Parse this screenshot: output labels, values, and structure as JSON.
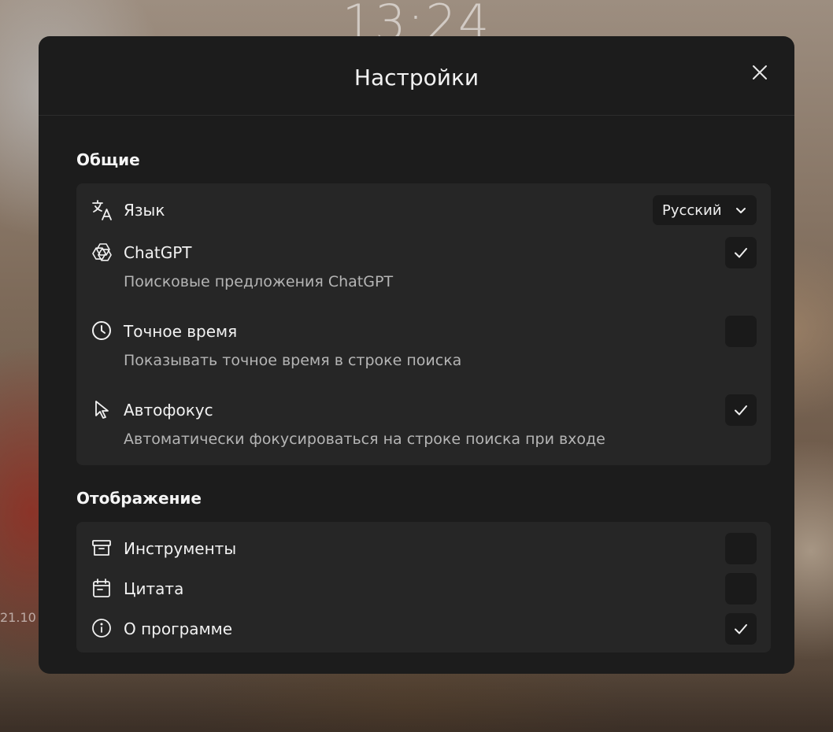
{
  "background": {
    "clock": "13:24",
    "side_label": "21.10"
  },
  "modal": {
    "title": "Настройки",
    "close_icon": "close-icon"
  },
  "sections": {
    "general": {
      "title": "Общие",
      "language": {
        "label": "Язык",
        "icon": "translate-icon",
        "selected": "Русский"
      },
      "chatgpt": {
        "label": "ChatGPT",
        "icon": "openai-icon",
        "description": "Поисковые предложения ChatGPT",
        "checked": true
      },
      "exact_time": {
        "label": "Точное время",
        "icon": "clock-icon",
        "description": "Показывать точное время в строке поиска",
        "checked": false
      },
      "autofocus": {
        "label": "Автофокус",
        "icon": "cursor-icon",
        "description": "Автоматически фокусироваться на строке поиска при входе",
        "checked": true
      }
    },
    "display": {
      "title": "Отображение",
      "tools": {
        "label": "Инструменты",
        "icon": "archive-icon",
        "checked": false
      },
      "quote": {
        "label": "Цитата",
        "icon": "calendar-icon",
        "checked": false
      },
      "about": {
        "label": "О программе",
        "icon": "info-icon",
        "checked": true
      }
    }
  },
  "colors": {
    "modal_bg": "#1c1c1c",
    "card_bg": "#262626",
    "control_bg": "#1a1a1a",
    "text": "#f2f2f2",
    "muted_text": "#b5b5b5"
  }
}
